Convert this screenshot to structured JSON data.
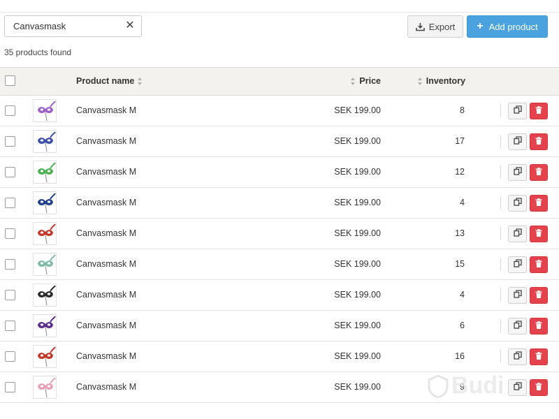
{
  "search": {
    "value": "Canvasmask",
    "clear_symbol": "✕"
  },
  "toolbar": {
    "export_label": "Export",
    "add_label": "Add product",
    "add_symbol": "+"
  },
  "results": {
    "count_text": "35 products found"
  },
  "table": {
    "columns": {
      "name": "Product name",
      "price": "Price",
      "inventory": "Inventory"
    },
    "rows": [
      {
        "name": "Canvasmask M",
        "price": "SEK 199.00",
        "inventory": "8",
        "thumb_color": "#9b5fc7"
      },
      {
        "name": "Canvasmask M",
        "price": "SEK 199.00",
        "inventory": "17",
        "thumb_color": "#3b4fa8"
      },
      {
        "name": "Canvasmask M",
        "price": "SEK 199.00",
        "inventory": "12",
        "thumb_color": "#4caf50"
      },
      {
        "name": "Canvasmask M",
        "price": "SEK 199.00",
        "inventory": "4",
        "thumb_color": "#1e3f8a"
      },
      {
        "name": "Canvasmask M",
        "price": "SEK 199.00",
        "inventory": "13",
        "thumb_color": "#c0392b"
      },
      {
        "name": "Canvasmask M",
        "price": "SEK 199.00",
        "inventory": "15",
        "thumb_color": "#7fb8a8"
      },
      {
        "name": "Canvasmask M",
        "price": "SEK 199.00",
        "inventory": "4",
        "thumb_color": "#2b2b2b"
      },
      {
        "name": "Canvasmask M",
        "price": "SEK 199.00",
        "inventory": "6",
        "thumb_color": "#5b2c8a"
      },
      {
        "name": "Canvasmask M",
        "price": "SEK 199.00",
        "inventory": "16",
        "thumb_color": "#c0392b"
      },
      {
        "name": "Canvasmask M",
        "price": "SEK 199.00",
        "inventory": "9",
        "thumb_color": "#e8a0b4"
      }
    ]
  },
  "watermark": {
    "text": "Budi"
  },
  "colors": {
    "primary": "#4aa3df",
    "danger": "#e2434c",
    "header_bg": "#f3f2ef"
  },
  "icons": {
    "export": "download-tray-icon",
    "duplicate": "copy-icon",
    "delete": "trash-icon"
  }
}
